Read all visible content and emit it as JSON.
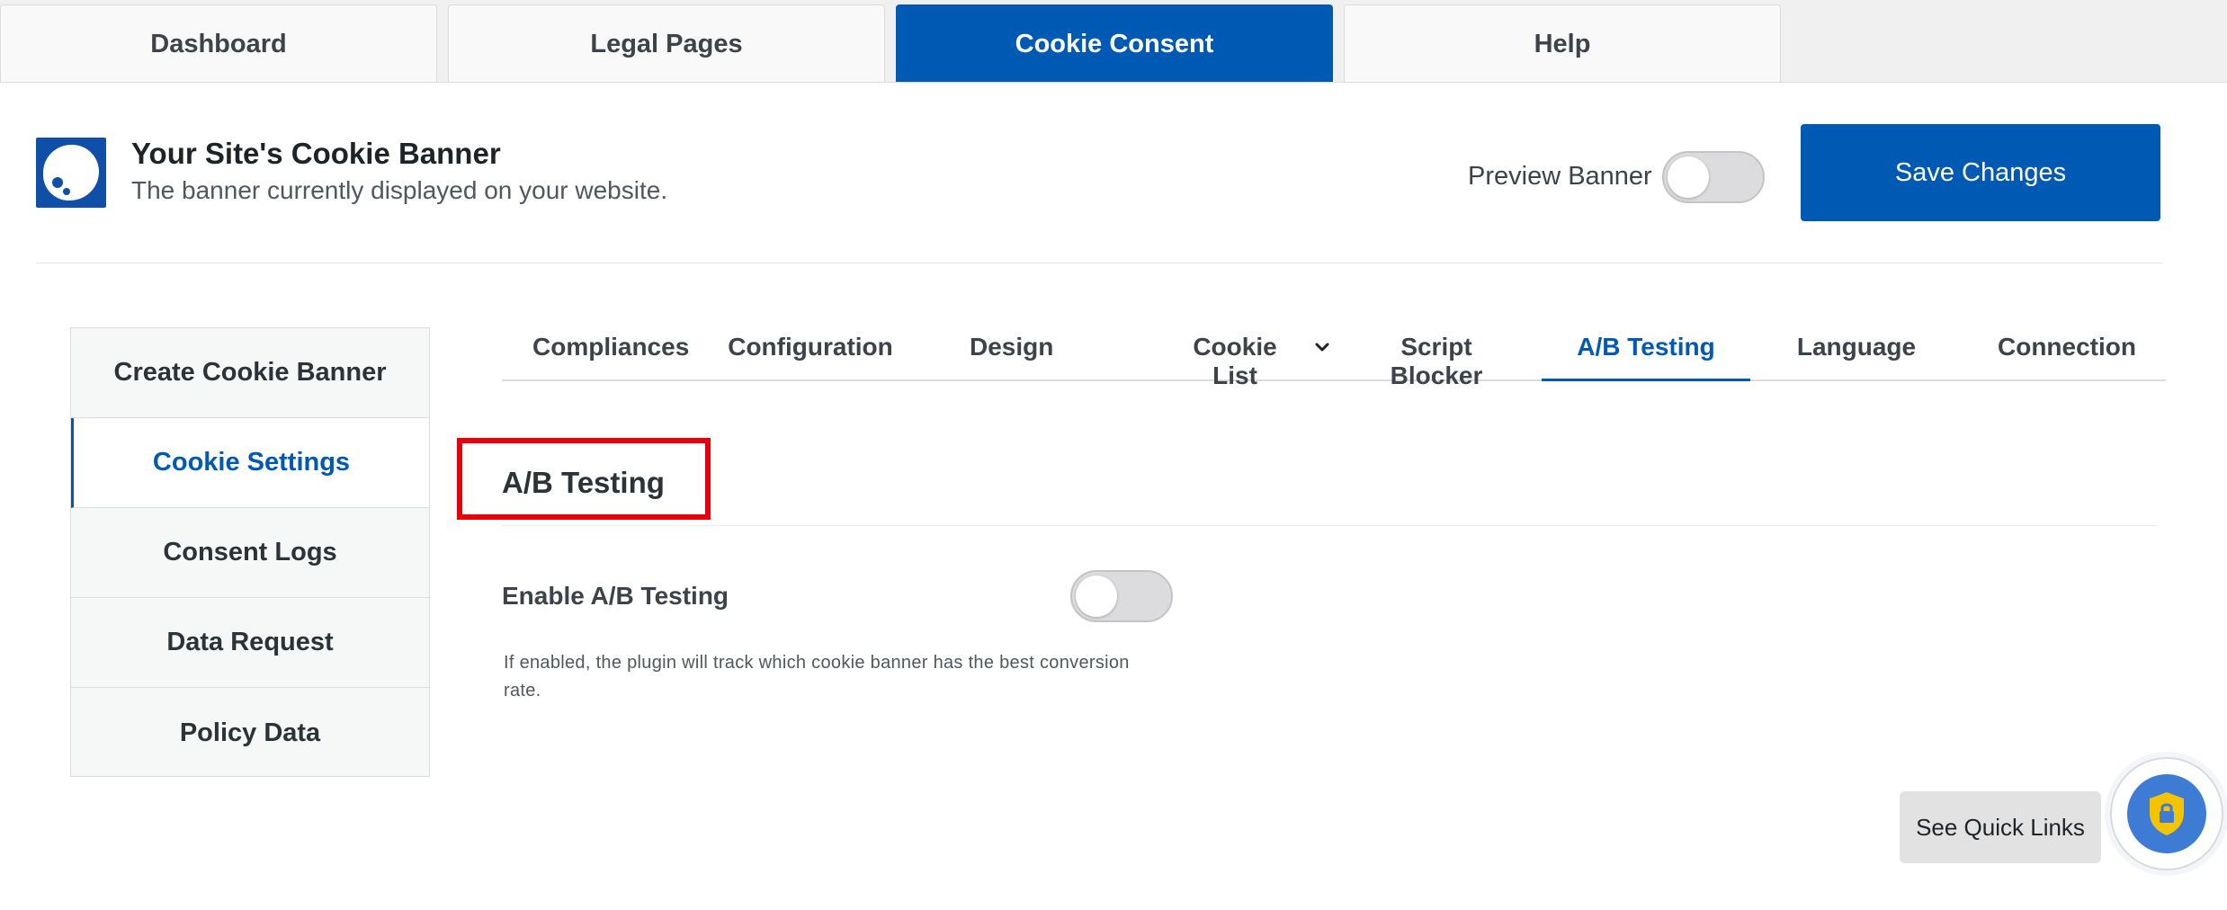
{
  "top_tabs": [
    {
      "label": "Dashboard",
      "active": false
    },
    {
      "label": "Legal Pages",
      "active": false
    },
    {
      "label": "Cookie Consent",
      "active": true
    },
    {
      "label": "Help",
      "active": false
    }
  ],
  "header": {
    "title": "Your Site's Cookie Banner",
    "subtitle": "The banner currently displayed on your website.",
    "preview_label": "Preview Banner",
    "preview_enabled": false,
    "save_label": "Save Changes"
  },
  "sidebar": {
    "items": [
      {
        "label": "Create Cookie Banner",
        "active": false
      },
      {
        "label": "Cookie Settings",
        "active": true
      },
      {
        "label": "Consent Logs",
        "active": false
      },
      {
        "label": "Data Request",
        "active": false
      },
      {
        "label": "Policy Data",
        "active": false
      }
    ]
  },
  "subtabs": [
    {
      "label": "Compliances",
      "active": false
    },
    {
      "label": "Configuration",
      "active": false
    },
    {
      "label": "Design",
      "active": false
    },
    {
      "label": "Cookie List",
      "active": false,
      "has_dropdown": true
    },
    {
      "label": "Script Blocker",
      "active": false
    },
    {
      "label": "A/B Testing",
      "active": true
    },
    {
      "label": "Language",
      "active": false
    },
    {
      "label": "Connection",
      "active": false
    }
  ],
  "section": {
    "title": "A/B Testing",
    "setting_label": "Enable A/B Testing",
    "setting_enabled": false,
    "help_text": "If enabled, the plugin will track which cookie banner has the best conversion rate."
  },
  "footer": {
    "quick_links_label": "See Quick Links"
  },
  "colors": {
    "accent": "#0059b3",
    "highlight_box": "#e8000b",
    "shield": "#3d7bd4",
    "shield_badge": "#f5c400"
  },
  "icons": {
    "logo": "cookie-blob-logo",
    "dropdown": "chevron-down-icon",
    "help_widget": "shield-lock-icon"
  }
}
